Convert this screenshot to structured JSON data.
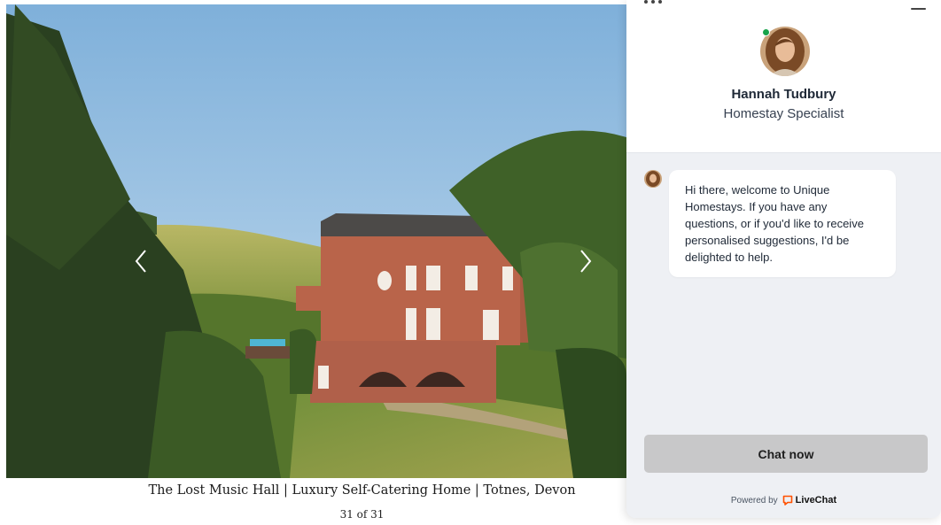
{
  "gallery": {
    "caption": "The Lost Music Hall | Luxury Self-Catering Home | Totnes, Devon",
    "counter": "31 of 31"
  },
  "chat": {
    "agent_name": "Hannah Tudbury",
    "agent_role": "Homestay Specialist",
    "status": "online",
    "message": "Hi there, welcome to Unique Homestays. If you have any questions, or if you'd like to receive personalised suggestions, I'd be delighted to help.",
    "cta_label": "Chat now",
    "powered_by": "Powered by",
    "brand": "LiveChat",
    "colors": {
      "online": "#16a34a",
      "brand": "#ff5100",
      "button": "#c8c8c9",
      "panel": "#eef0f4"
    }
  }
}
